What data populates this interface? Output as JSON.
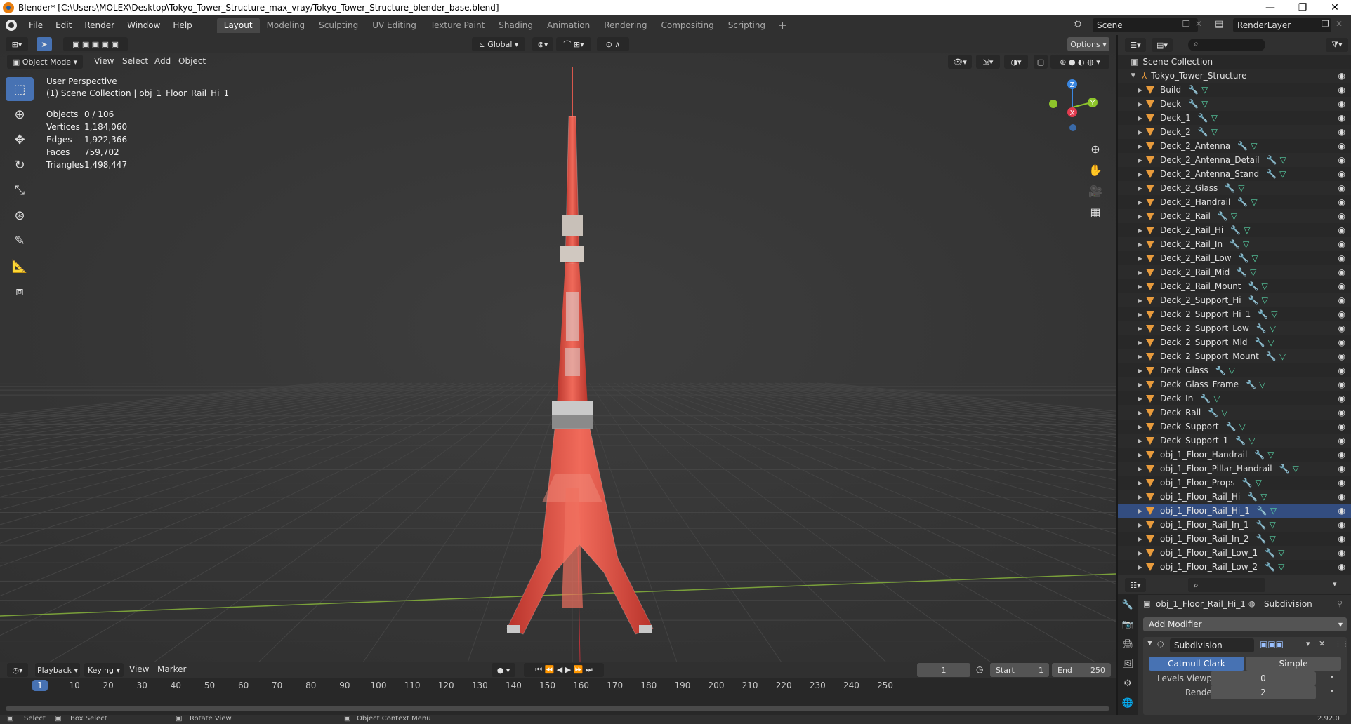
{
  "window": {
    "title": "Blender* [C:\\Users\\MOLEX\\Desktop\\Tokyo_Tower_Structure_max_vray/Tokyo_Tower_Structure_blender_base.blend]",
    "minimize": "—",
    "maximize": "❐",
    "close": "✕"
  },
  "menu": [
    "File",
    "Edit",
    "Render",
    "Window",
    "Help"
  ],
  "workspaces": [
    "Layout",
    "Modeling",
    "Sculpting",
    "UV Editing",
    "Texture Paint",
    "Shading",
    "Animation",
    "Rendering",
    "Compositing",
    "Scripting"
  ],
  "workspace_add": "+",
  "scene": {
    "name": "Scene",
    "render_layer": "RenderLayer"
  },
  "viewport_header": {
    "transform_orientation": "Global",
    "options_label": "Options",
    "mode": "Object Mode",
    "menus": [
      "View",
      "Select",
      "Add",
      "Object"
    ]
  },
  "overlay": {
    "view_name": "User Perspective",
    "collection_info": "(1) Scene Collection | obj_1_Floor_Rail_Hi_1"
  },
  "stats": [
    {
      "label": "Objects",
      "value": "0 / 106"
    },
    {
      "label": "Vertices",
      "value": "1,184,060"
    },
    {
      "label": "Edges",
      "value": "1,922,366"
    },
    {
      "label": "Faces",
      "value": "759,702"
    },
    {
      "label": "Triangles",
      "value": "1,498,447"
    }
  ],
  "gizmo": {
    "x": "X",
    "y": "Y",
    "z": "Z",
    "x_color": "#e23b4f",
    "y_color": "#8ec52b",
    "z_color": "#3a86e0"
  },
  "timeline": {
    "menus": [
      "Playback",
      "Keying",
      "View",
      "Marker"
    ],
    "current_frame": "1",
    "start_label": "Start",
    "start": "1",
    "end_label": "End",
    "end": "250",
    "ticks": [
      "1",
      "10",
      "20",
      "30",
      "40",
      "50",
      "60",
      "70",
      "80",
      "90",
      "100",
      "110",
      "120",
      "130",
      "140",
      "150",
      "160",
      "170",
      "180",
      "190",
      "200",
      "210",
      "220",
      "230",
      "240",
      "250"
    ],
    "marker": "1"
  },
  "statusbar": {
    "select": "Select",
    "box_select": "Box Select",
    "rotate": "Rotate View",
    "context": "Object Context Menu",
    "version": "2.92.0"
  },
  "outliner": {
    "search_icon": "⌕",
    "root": "Scene Collection",
    "collection": "Tokyo_Tower_Structure",
    "items": [
      "Build",
      "Deck",
      "Deck_1",
      "Deck_2",
      "Deck_2_Antenna",
      "Deck_2_Antenna_Detail",
      "Deck_2_Antenna_Stand",
      "Deck_2_Glass",
      "Deck_2_Handrail",
      "Deck_2_Rail",
      "Deck_2_Rail_Hi",
      "Deck_2_Rail_In",
      "Deck_2_Rail_Low",
      "Deck_2_Rail_Mid",
      "Deck_2_Rail_Mount",
      "Deck_2_Support_Hi",
      "Deck_2_Support_Hi_1",
      "Deck_2_Support_Low",
      "Deck_2_Support_Mid",
      "Deck_2_Support_Mount",
      "Deck_Glass",
      "Deck_Glass_Frame",
      "Deck_In",
      "Deck_Rail",
      "Deck_Support",
      "Deck_Support_1",
      "obj_1_Floor_Handrail",
      "obj_1_Floor_Pillar_Handrail",
      "obj_1_Floor_Props",
      "obj_1_Floor_Rail_Hi",
      "obj_1_Floor_Rail_Hi_1",
      "obj_1_Floor_Rail_In_1",
      "obj_1_Floor_Rail_In_2",
      "obj_1_Floor_Rail_Low_1",
      "obj_1_Floor_Rail_Low_2"
    ],
    "selected_index": 30
  },
  "properties": {
    "object_name": "obj_1_Floor_Rail_Hi_1",
    "modifier_tab": "Subdivision",
    "add_modifier": "Add Modifier",
    "modifier_name": "Subdivision",
    "algo_catmull": "Catmull-Clark",
    "algo_simple": "Simple",
    "levels_viewport_label": "Levels Viewport",
    "levels_viewport": "0",
    "render_label": "Render",
    "render": "2"
  }
}
